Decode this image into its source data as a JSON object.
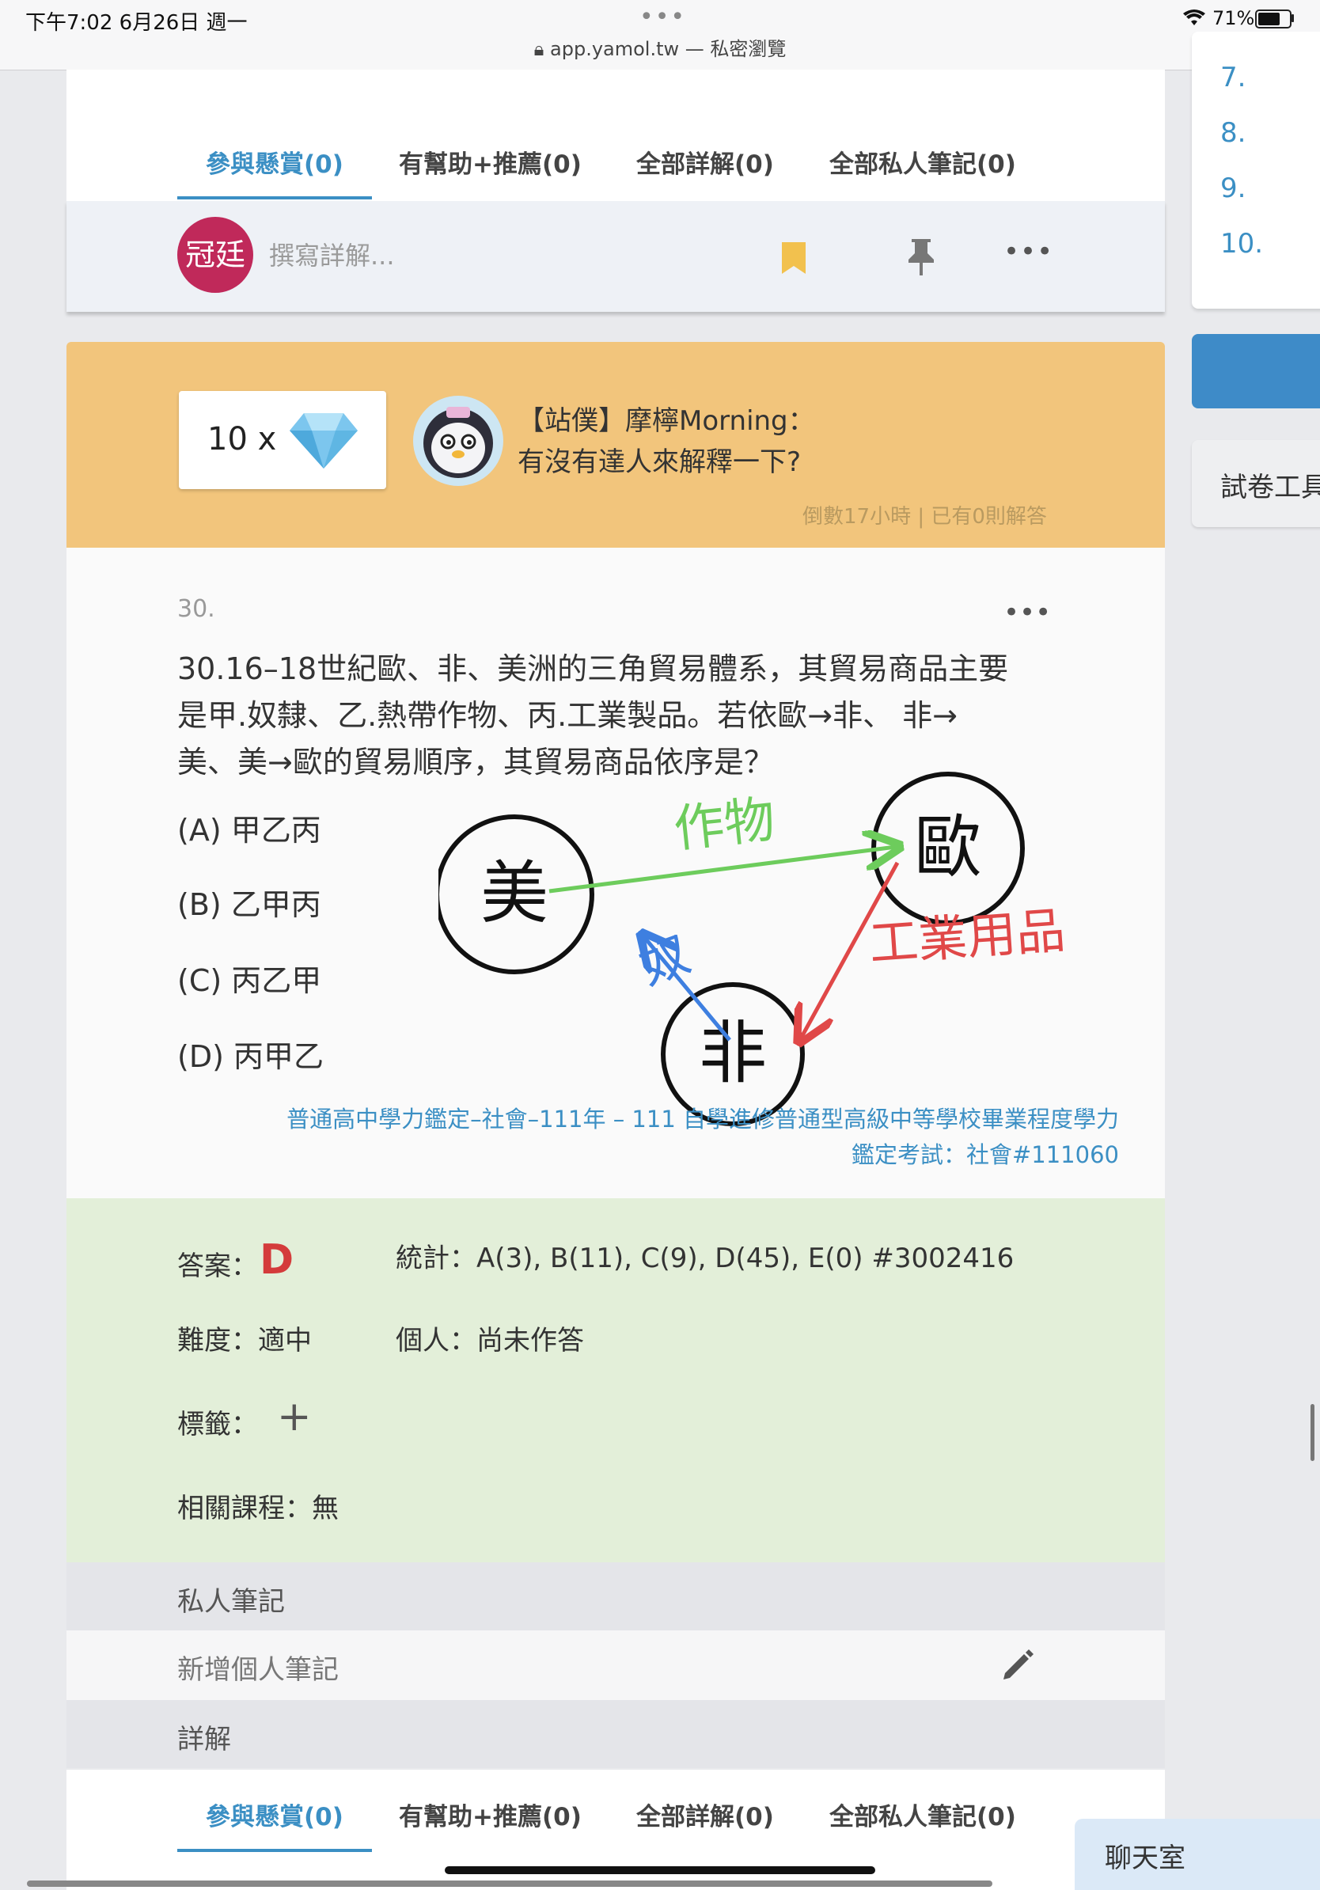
{
  "status_bar": {
    "time": "下午7:02   6月26日 週一",
    "url": "app.yamol.tw — 私密瀏覽",
    "battery": "71%",
    "battery_level": 0.71
  },
  "tabs_top": [
    {
      "label": "參與懸賞(0)",
      "active": true
    },
    {
      "label": "有幫助+推薦(0)",
      "active": false
    },
    {
      "label": "全部詳解(0)",
      "active": false
    },
    {
      "label": "全部私人筆記(0)",
      "active": false
    }
  ],
  "write_bar": {
    "avatar_text": "冠廷",
    "placeholder": "撰寫詳解..."
  },
  "bounty": {
    "gems": "10 x",
    "name": "【站僕】摩檸Morning：",
    "message": "有沒有達人來解釋一下?",
    "meta": "倒數17小時 | 已有0則解答"
  },
  "question": {
    "number": "30.",
    "lines": [
      "30.16–18世紀歐、非、美洲的三角貿易體系，其貿易商品主要",
      "是甲.奴隸、乙.熱帶作物、丙.工業製品。若依歐→非、 非→",
      "美、美→歐的貿易順序，其貿易商品依序是？"
    ],
    "options": [
      "(A) 甲乙丙",
      "(B) 乙甲丙",
      "(C) 丙乙甲",
      "(D) 丙甲乙"
    ],
    "source_line1": "普通高中學力鑑定–社會–111年 – 111 自學進修普通型高級中等學校畢業程度學力",
    "source_line2": "鑑定考試：社會#111060",
    "drawing": {
      "circle_america": "美",
      "circle_europe": "歐",
      "circle_africa": "非",
      "label_crops": "作物",
      "label_industry": "工業用品",
      "label_slave": "奴",
      "green": "#6dcc5c",
      "red": "#e04848",
      "blue": "#3e7fe0"
    }
  },
  "answer": {
    "answer_label": "答案：",
    "answer_value": "D",
    "stats": "統計：A(3), B(11), C(9), D(45), E(0) #3002416",
    "difficulty": "難度：適中",
    "personal": "個人：尚未作答",
    "tags_label": "標籤：",
    "tags_add": "+",
    "courses": "相關課程：無"
  },
  "private_notes": {
    "title": "私人筆記",
    "add": "新增個人筆記"
  },
  "explanations": {
    "title": "詳解"
  },
  "tabs_bottom": [
    {
      "label": "參與懸賞(0)",
      "active": true
    },
    {
      "label": "有幫助+推薦(0)",
      "active": false
    },
    {
      "label": "全部詳解(0)",
      "active": false
    },
    {
      "label": "全部私人筆記(0)",
      "active": false
    }
  ],
  "sidebar": {
    "numbers": [
      "7.",
      "8.",
      "9.",
      "10."
    ],
    "tools": "試卷工具"
  },
  "chat": "聊天室",
  "colors": {
    "accent": "#3b8fc4",
    "answer_red": "#d43b3b",
    "bounty_bg": "#f2c57c",
    "answer_bg": "#e3efd9",
    "bookmark": "#f2c14e"
  }
}
